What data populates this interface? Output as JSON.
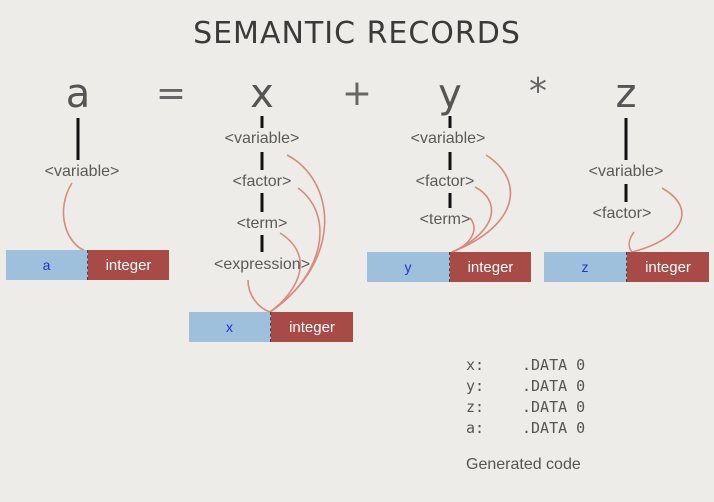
{
  "title": "SEMANTIC RECORDS",
  "expression": {
    "a": "a",
    "eq": "=",
    "x": "x",
    "plus": "+",
    "y": "y",
    "times": "*",
    "z": "z"
  },
  "nonterminals": {
    "variable": "<variable>",
    "factor": "<factor>",
    "term": "<term>",
    "expression": "<expression>"
  },
  "records": {
    "a": {
      "name": "a",
      "type": "integer"
    },
    "x": {
      "name": "x",
      "type": "integer"
    },
    "y": {
      "name": "y",
      "type": "integer"
    },
    "z": {
      "name": "z",
      "type": "integer"
    }
  },
  "code": [
    {
      "label": "x:",
      "instr": ".DATA 0"
    },
    {
      "label": "y:",
      "instr": ".DATA 0"
    },
    {
      "label": "z:",
      "instr": ".DATA 0"
    },
    {
      "label": "a:",
      "instr": ".DATA 0"
    }
  ],
  "caption": "Generated code",
  "colors": {
    "name_cell": "#9ec0dc",
    "type_cell": "#a84a45",
    "arrow": "#d88a7c"
  }
}
